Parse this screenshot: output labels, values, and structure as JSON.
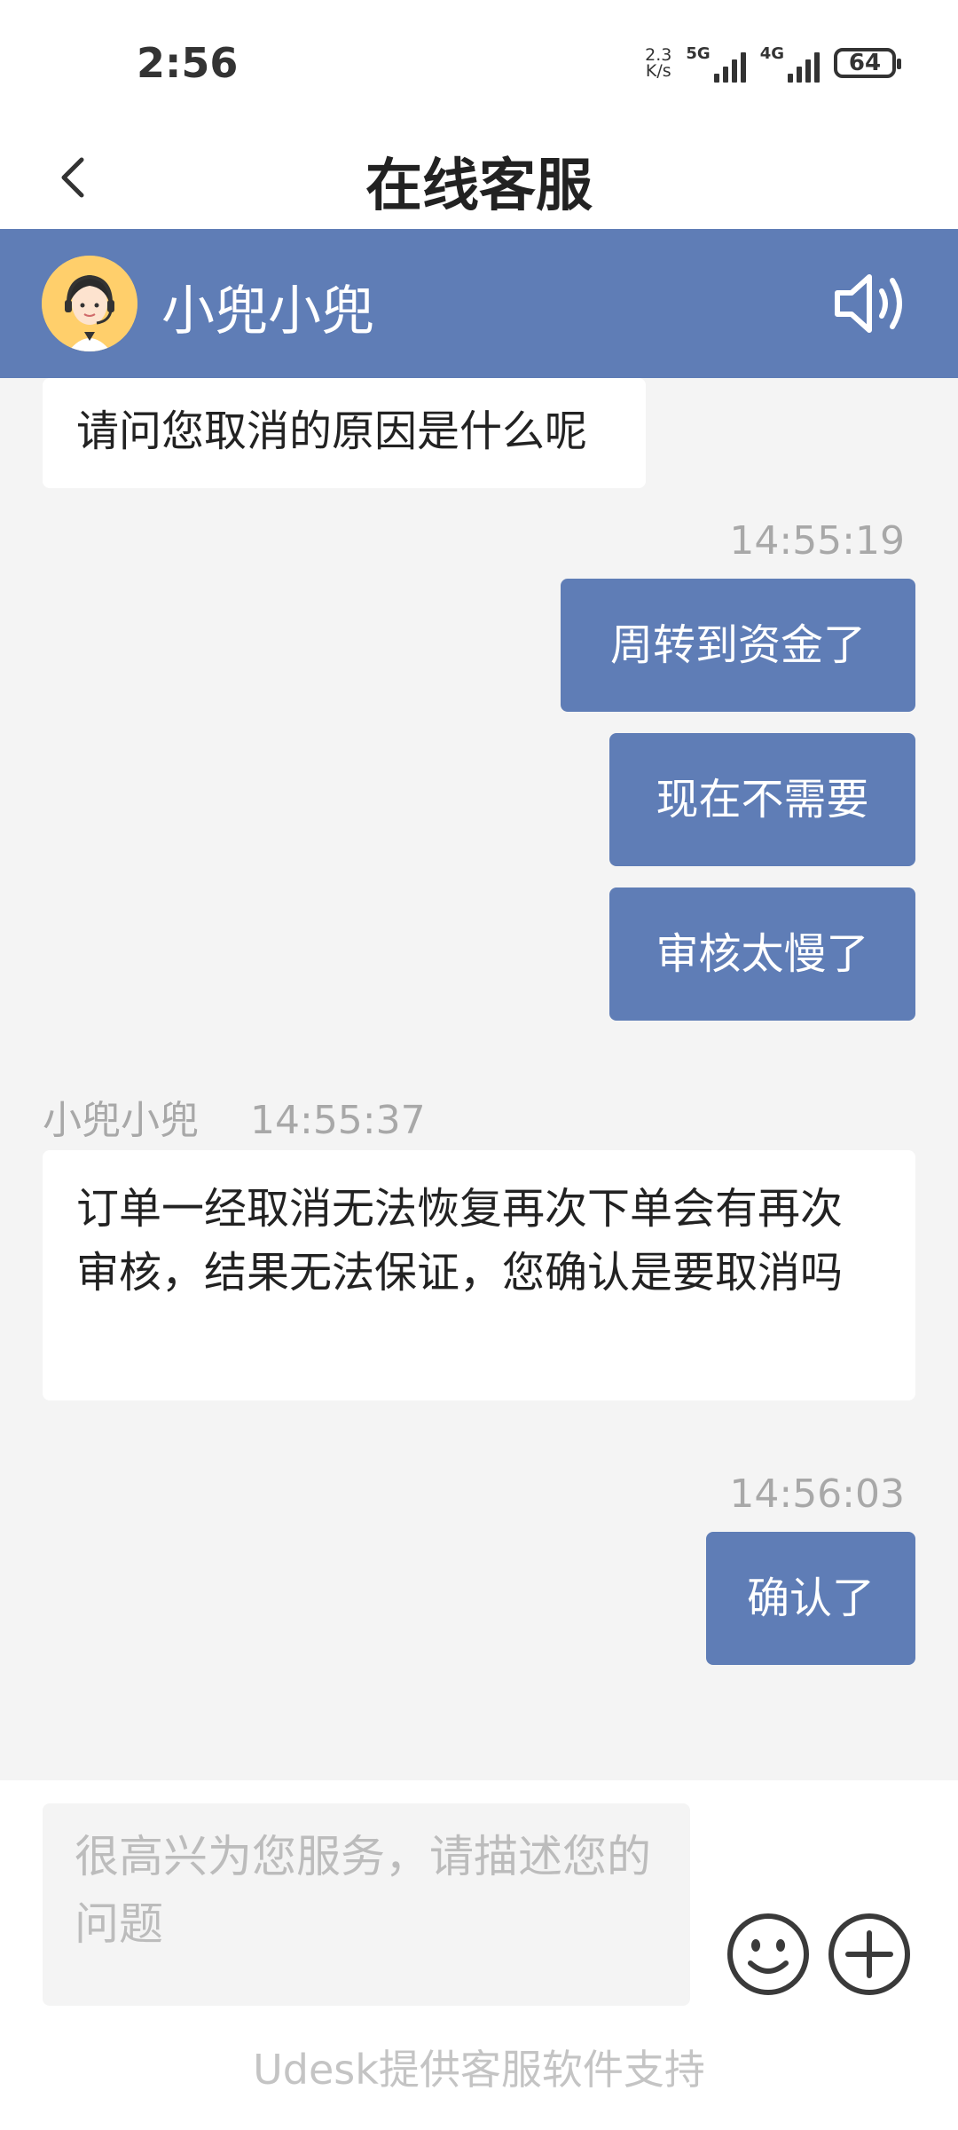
{
  "status": {
    "time": "2:56",
    "speed_value": "2.3",
    "speed_unit": "K/s",
    "net1": "5G",
    "net2": "4G",
    "battery": "64"
  },
  "header": {
    "title": "在线客服"
  },
  "agent": {
    "name": "小兜小兜"
  },
  "messages": [
    {
      "text": "请问您取消的原因是什么呢"
    },
    {
      "time": "14:55:19"
    },
    {
      "text": "周转到资金了"
    },
    {
      "text": "现在不需要"
    },
    {
      "text": "审核太慢了"
    },
    {
      "sender": "小兜小兜",
      "time": "14:55:37"
    },
    {
      "text": "订单一经取消无法恢复再次下单会有再次审核，结果无法保证，您确认是要取消吗"
    },
    {
      "time": "14:56:03"
    },
    {
      "text": "确认了"
    }
  ],
  "footer": {
    "placeholder": "很高兴为您服务，请描述您的问题",
    "powered_by": "Udesk提供客服软件支持"
  },
  "colors": {
    "accent": "#5f7db6",
    "background": "#f4f4f4"
  }
}
